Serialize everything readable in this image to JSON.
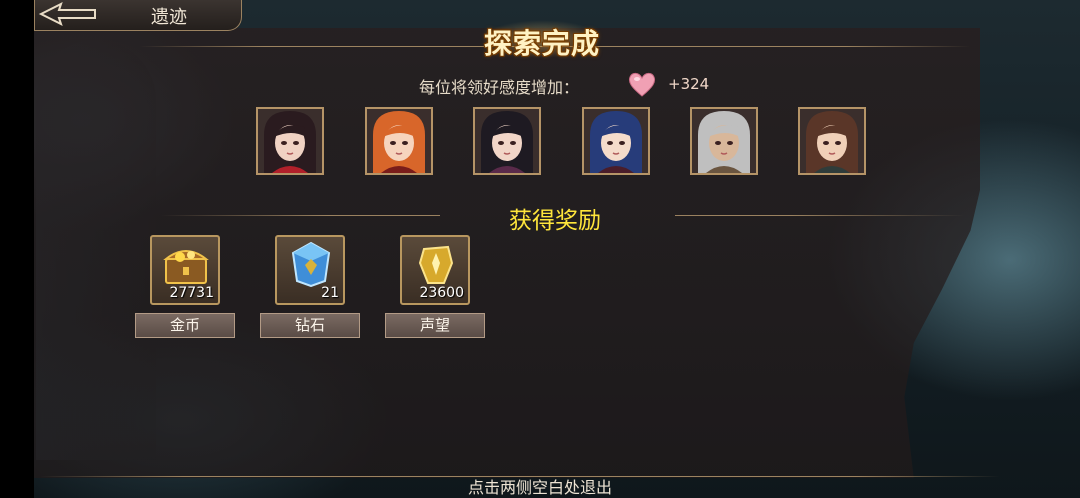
{
  "header": {
    "title": "遗迹",
    "back_icon": "back-arrow-icon"
  },
  "banner": {
    "title": "探索完成"
  },
  "affinity": {
    "label": "每位将领好感度增加：",
    "icon": "heart-icon",
    "value": "+324"
  },
  "portraits": [
    {
      "name": "portrait-1",
      "hair": "#2a1b1f",
      "skin": "#f0d2c3",
      "accent": "#b2202a"
    },
    {
      "name": "portrait-2",
      "hair": "#d8662a",
      "skin": "#f6d4bd",
      "accent": "#7a1d1a"
    },
    {
      "name": "portrait-3",
      "hair": "#1e1a22",
      "skin": "#f2d6c8",
      "accent": "#5a2a4a"
    },
    {
      "name": "portrait-4",
      "hair": "#273c7a",
      "skin": "#f5dccb",
      "accent": "#4a1d2a"
    },
    {
      "name": "portrait-5",
      "hair": "#bfbfbf",
      "skin": "#d8b79a",
      "accent": "#6a5540"
    },
    {
      "name": "portrait-6",
      "hair": "#5a3628",
      "skin": "#f0d0b8",
      "accent": "#2f3c3a"
    }
  ],
  "rewards": {
    "title": "获得奖励",
    "items": [
      {
        "icon": "treasure-chest-icon",
        "count": "27731",
        "label": "金币"
      },
      {
        "icon": "crystal-icon",
        "count": "21",
        "label": "钻石"
      },
      {
        "icon": "badge-icon",
        "count": "23600",
        "label": "声望"
      }
    ]
  },
  "footer": {
    "hint": "点击两侧空白处退出"
  },
  "colors": {
    "reward_title": "#ffe63b",
    "frame": "#b8975f",
    "heart": "#f0a0b4"
  }
}
